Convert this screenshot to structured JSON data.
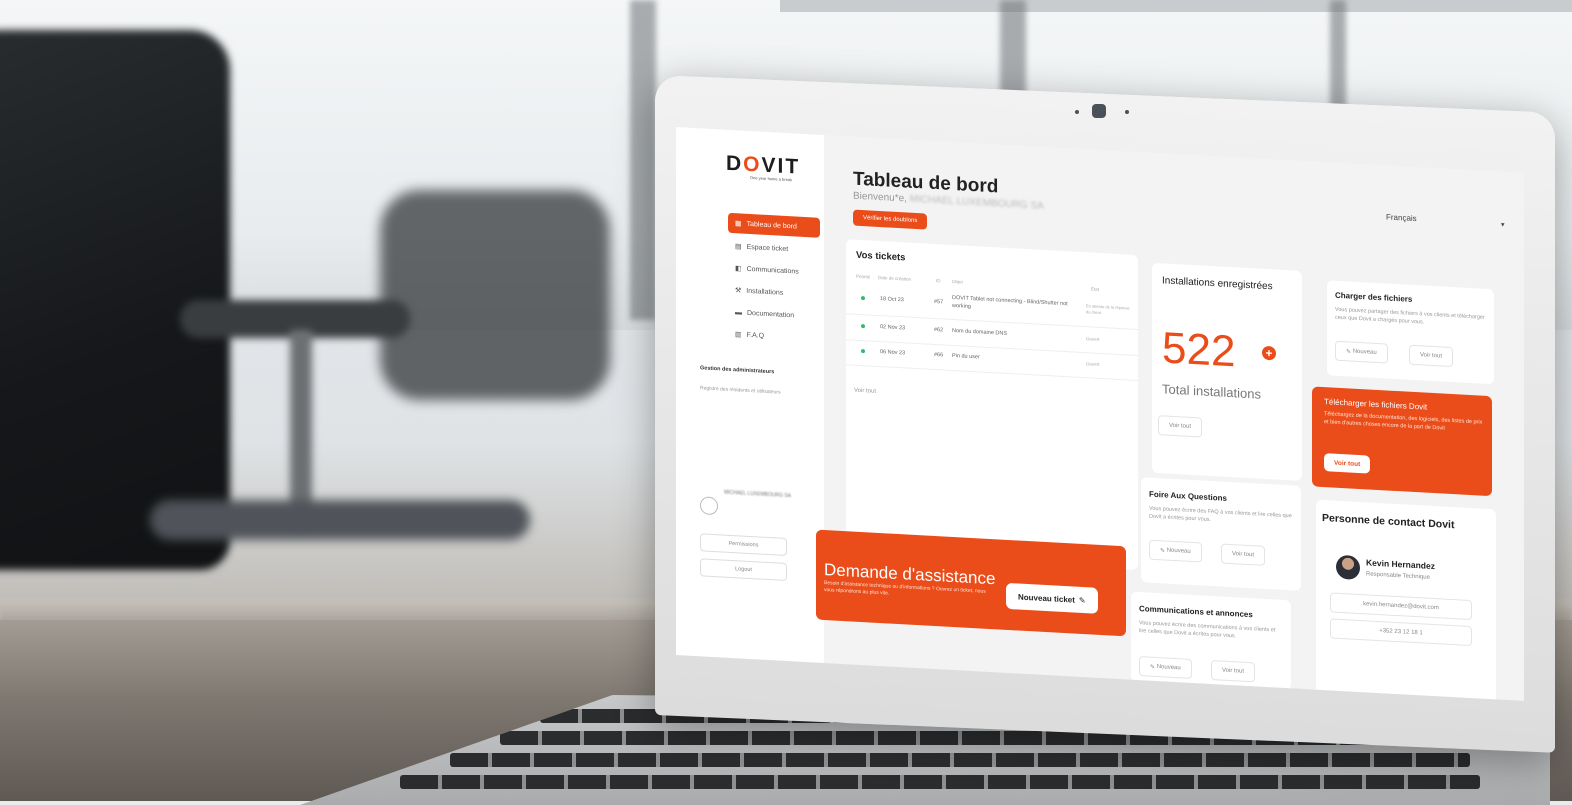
{
  "brand": {
    "logo": "DOVIT",
    "tagline": "One year home a break"
  },
  "sidebar": {
    "items": [
      {
        "label": "Tableau de bord",
        "icon": "dashboard-icon",
        "active": true
      },
      {
        "label": "Espace ticket",
        "icon": "ticket-icon"
      },
      {
        "label": "Communications",
        "icon": "megaphone-icon"
      },
      {
        "label": "Installations",
        "icon": "wrench-icon"
      },
      {
        "label": "Documentation",
        "icon": "folder-icon"
      },
      {
        "label": "F.A.Q",
        "icon": "book-icon"
      }
    ],
    "admin_title": "Gestion des administrateurs",
    "admin_desc": "Registre des résidents et utilisateurs",
    "profile_name": "MICHAEL LUXEMBOURG SA",
    "permissions_label": "Permissions",
    "logout_label": "Logout"
  },
  "header": {
    "title": "Tableau de bord",
    "welcome_prefix": "Bienvenu*e,",
    "welcome_name": "MICHAEL LUXEMBOURG SA",
    "verify_label": "Vérifier les doublons",
    "language": "Français"
  },
  "tickets": {
    "title": "Vos tickets",
    "columns": [
      "Priorité",
      "Date de création",
      "ID",
      "Objet",
      "État"
    ],
    "rows": [
      {
        "date": "18 Oct 23",
        "id": "#57",
        "object": "DOVIT Tablet not connecting - Blind/Shutter not working",
        "state": "En attente de la réponse du client"
      },
      {
        "date": "02 Nov 23",
        "id": "#62",
        "object": "Nom du domaine DNS",
        "state": "Ouvert"
      },
      {
        "date": "06 Nov 23",
        "id": "#66",
        "object": "Pin du user",
        "state": "Ouvert"
      }
    ],
    "see_all": "Voir tout"
  },
  "installations": {
    "title": "Installations enregistrées",
    "count": "522",
    "label": "Total installations",
    "see_all": "Voir tout"
  },
  "files": {
    "title": "Charger des fichiers",
    "desc": "Vous pouvez partager des fichiers à vos clients et télécharger ceux que Dovit a chargés pour vous.",
    "new_label": "Nouveau",
    "see_all": "Voir tout"
  },
  "download": {
    "title": "Télécharger les fichiers Dovit",
    "desc": "Téléchargez de la documentation, des logiciels, des listes de prix et bien d'autres choses encore de la part de Dovit",
    "button": "Voir tout"
  },
  "faq": {
    "title": "Foire Aux Questions",
    "desc": "Vous pouvez écrire des FAQ à vos clients et lire celles que Dovit a écrites pour vous.",
    "new_label": "Nouveau",
    "see_all": "Voir tout"
  },
  "contact": {
    "title": "Personne de contact Dovit",
    "name": "Kevin Hernandez",
    "role": "Responsable Technique",
    "email": "kevin.hernandez@dovit.com",
    "phone": "+352 23 12 18 1"
  },
  "assistance": {
    "title": "Demande d'assistance",
    "desc": "Besoin d'assistance technique ou d'informations ? Ouvrez un ticket, nous vous répondrons au plus vite.",
    "button": "Nouveau ticket"
  },
  "comms": {
    "title": "Communications et annonces",
    "desc": "Vous pouvez écrire des communications à vos clients et lire celles que Dovit a écrites pour vous.",
    "new_label": "Nouveau",
    "see_all": "Voir tout"
  },
  "colors": {
    "accent": "#ea4d1a",
    "status_ok": "#2ebd6b"
  }
}
